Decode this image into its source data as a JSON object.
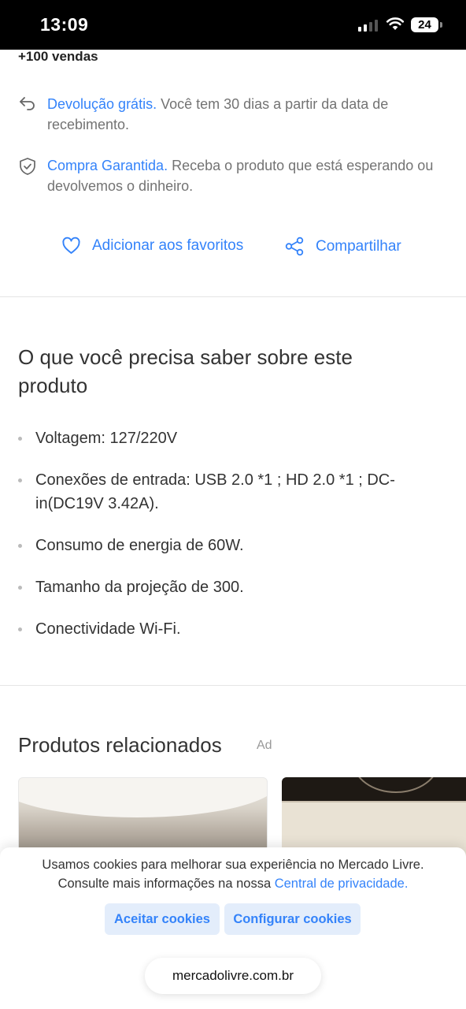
{
  "status_bar": {
    "time": "13:09",
    "battery": "24"
  },
  "product": {
    "sales": "+100 vendas"
  },
  "benefits": [
    {
      "link": "Devolução grátis.",
      "text": " Você tem 30 dias a partir da data de recebimento."
    },
    {
      "link": "Compra Garantida.",
      "text": " Receba o produto que está esperando ou devolvemos o dinheiro."
    }
  ],
  "actions": {
    "favorite": "Adicionar aos favoritos",
    "share": "Compartilhar"
  },
  "specs": {
    "title": "O que você precisa saber sobre este produto",
    "items": [
      "Voltagem: 127/220V",
      "Conexões de entrada: USB 2.0 *1 ; HD 2.0 *1 ; DC-in(DC19V 3.42A).",
      "Consumo de energia de 60W.",
      "Tamanho da projeção de 300.",
      "Conectividade Wi-Fi."
    ]
  },
  "related": {
    "title": "Produtos relacionados",
    "ad_label": "Ad"
  },
  "cookies": {
    "line1": "Usamos cookies para melhorar sua experiência no Mercado Livre.",
    "line2": "Consulte mais informações na nossa ",
    "link": "Central de privacidade.",
    "accept": "Aceitar cookies",
    "configure": "Configurar cookies"
  },
  "browser": {
    "url": "mercadolivre.com.br"
  },
  "colors": {
    "accent": "#3483fa",
    "text": "#333333",
    "muted": "#737373"
  }
}
